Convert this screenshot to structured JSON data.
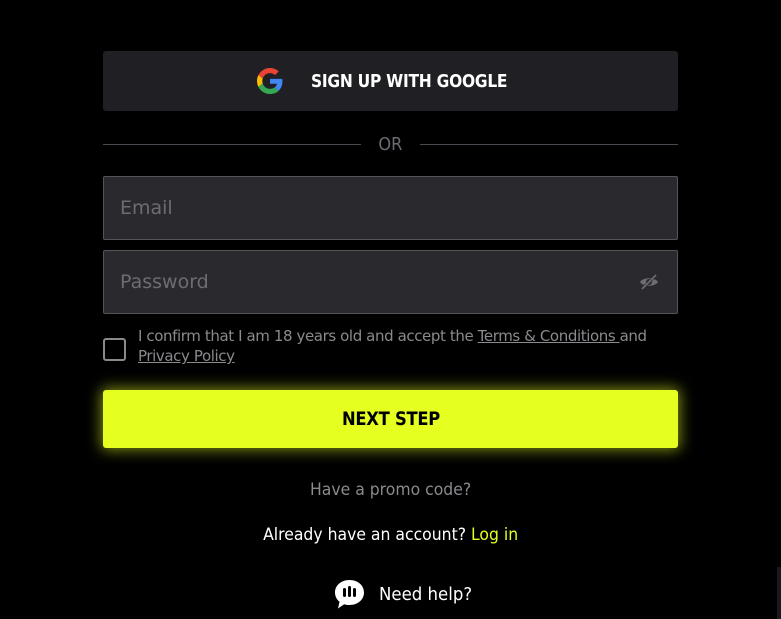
{
  "google_button": {
    "label": "SIGN UP WITH GOOGLE",
    "icon": "google-icon"
  },
  "divider": {
    "label": "OR"
  },
  "email_field": {
    "placeholder": "Email",
    "value": ""
  },
  "password_field": {
    "placeholder": "Password",
    "value": "",
    "toggle_icon": "eye-off-icon"
  },
  "consent": {
    "checked": false,
    "prefix": "I confirm that I am 18 years old and accept the ",
    "terms_link": "Terms & Conditions ",
    "middle": "and ",
    "privacy_link": "Privacy Policy"
  },
  "next_button": {
    "label": "NEXT STEP"
  },
  "promo": {
    "label": "Have a promo code?"
  },
  "login_prompt": {
    "text": "Already have an account? ",
    "link": "Log in"
  },
  "help": {
    "label": "Need help?",
    "icon": "chat-bubble-icon"
  },
  "colors": {
    "background": "#000000",
    "accent": "#e5ff20",
    "surface": "#202024",
    "input_bg": "#2a2a2e",
    "muted_text": "#8a8a8e"
  }
}
